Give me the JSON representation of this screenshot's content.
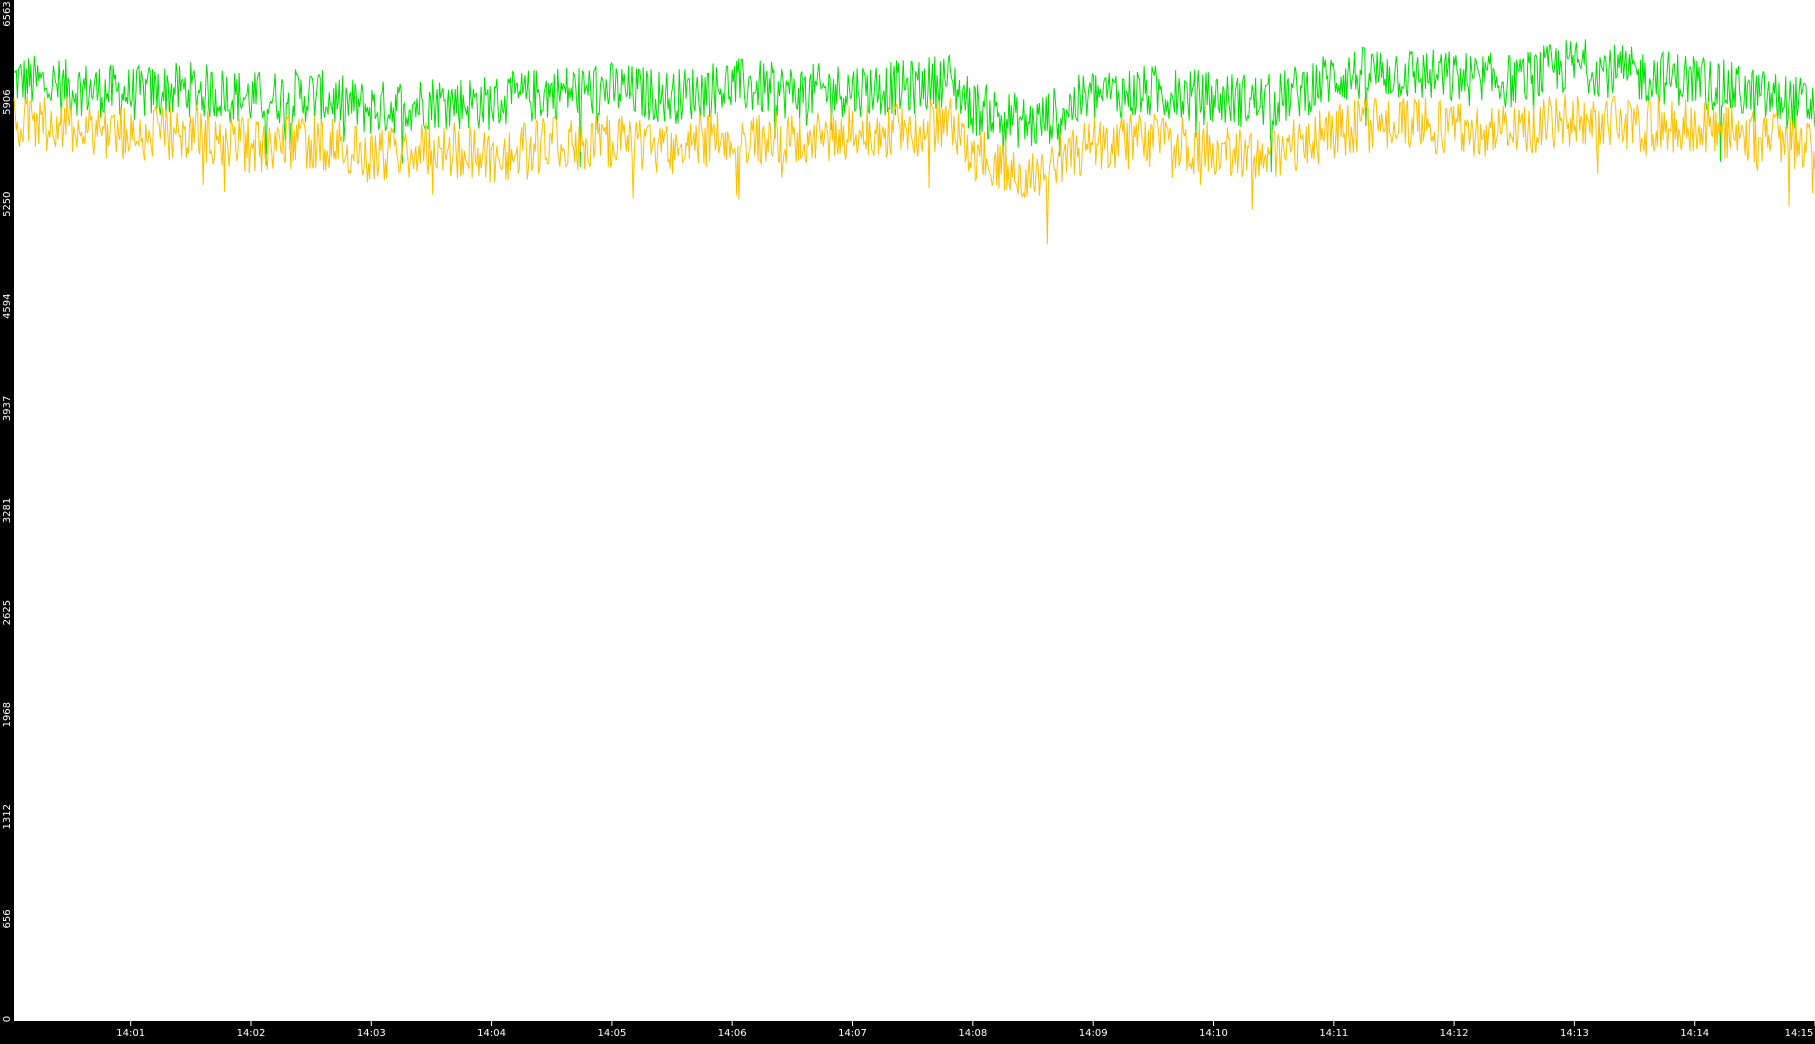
{
  "chart_data": {
    "type": "line",
    "title": "",
    "xlabel": "",
    "ylabel": "",
    "grid": false,
    "legend": "none",
    "background": "#000000",
    "plot_background": "#ffffff",
    "axis_text_color": "#ffffff",
    "y_ticks": [
      "0",
      "656",
      "1312",
      "1968",
      "2625",
      "3281",
      "3937",
      "4594",
      "5250",
      "5906",
      "6563"
    ],
    "ylim": [
      0,
      6563
    ],
    "x_ticks": [
      "14:01",
      "14:02",
      "14:03",
      "14:04",
      "14:05",
      "14:06",
      "14:07",
      "14:08",
      "14:09",
      "14:10",
      "14:11",
      "14:12",
      "14:13",
      "14:14",
      "14:15"
    ],
    "x_tick_minutes": [
      1,
      2,
      3,
      4,
      5,
      6,
      7,
      8,
      9,
      10,
      11,
      12,
      13,
      14,
      15
    ],
    "xlim_minutes": [
      0.03,
      15.0
    ],
    "series": [
      {
        "color": "#00e000",
        "x_minutes": [
          0.03,
          0.5,
          1.0,
          1.5,
          2.0,
          2.5,
          3.0,
          3.5,
          4.0,
          4.5,
          5.0,
          5.5,
          6.0,
          6.5,
          7.0,
          7.5,
          7.8,
          8.0,
          8.5,
          9.0,
          9.5,
          10.0,
          10.5,
          11.0,
          11.5,
          12.0,
          12.5,
          13.0,
          13.5,
          14.0,
          14.5,
          15.0
        ],
        "values": [
          6050,
          6000,
          5960,
          5990,
          5930,
          5950,
          5860,
          5910,
          5900,
          5970,
          5990,
          5940,
          6020,
          5970,
          5990,
          6000,
          6060,
          5870,
          5760,
          5950,
          5970,
          5930,
          5910,
          6070,
          6100,
          6060,
          6040,
          6150,
          6080,
          6050,
          5950,
          5880
        ]
      },
      {
        "color": "#ffc000",
        "x_minutes": [
          0.03,
          0.5,
          1.0,
          1.5,
          2.0,
          2.5,
          3.0,
          3.5,
          4.0,
          4.5,
          5.0,
          5.5,
          6.0,
          6.5,
          7.0,
          7.5,
          7.8,
          8.0,
          8.5,
          9.0,
          9.5,
          10.0,
          10.5,
          11.0,
          11.5,
          12.0,
          12.5,
          13.0,
          13.5,
          14.0,
          14.5,
          15.0
        ],
        "values": [
          5780,
          5760,
          5700,
          5720,
          5620,
          5660,
          5560,
          5620,
          5560,
          5640,
          5660,
          5620,
          5700,
          5660,
          5720,
          5720,
          5780,
          5580,
          5450,
          5640,
          5660,
          5600,
          5580,
          5720,
          5780,
          5740,
          5720,
          5800,
          5760,
          5760,
          5680,
          5640
        ]
      }
    ]
  }
}
